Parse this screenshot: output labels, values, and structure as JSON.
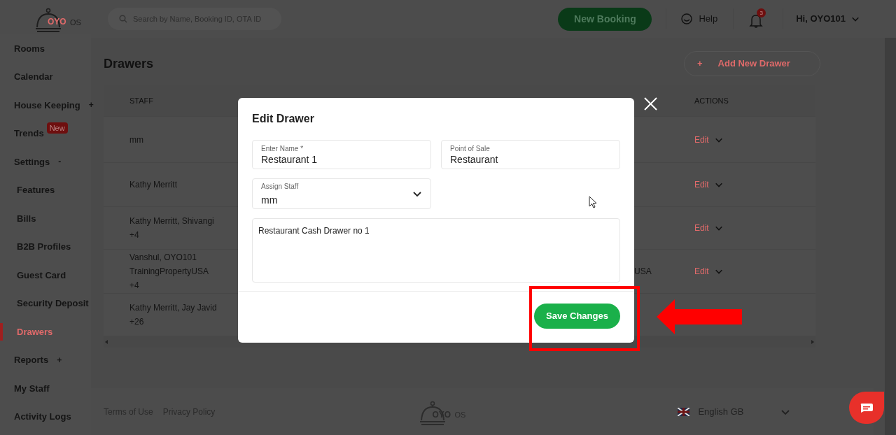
{
  "header": {
    "logo": "OYO",
    "logo_suffix": "OS",
    "search": {
      "placeholder": "Search by Name, Booking ID, OTA ID"
    },
    "new_booking": "New Booking",
    "help": "Help",
    "notifications": "3",
    "user": "Hi, OYO101"
  },
  "sidebar": {
    "items": [
      {
        "label": "Rooms",
        "selected": false
      },
      {
        "label": "Calendar",
        "selected": false
      },
      {
        "label": "House Keeping",
        "toggle": "+",
        "selected": false
      },
      {
        "label": "Trends",
        "badge": "New",
        "selected": false
      },
      {
        "label": "Settings",
        "toggle": "-",
        "selected": false,
        "children": [
          {
            "label": "Features",
            "selected": false
          },
          {
            "label": "Bills",
            "selected": false
          },
          {
            "label": "B2B Profiles",
            "selected": false
          },
          {
            "label": "Guest Card",
            "selected": false
          },
          {
            "label": "Security Deposit",
            "selected": false
          },
          {
            "label": "Drawers",
            "selected": true
          }
        ]
      },
      {
        "label": "Reports",
        "toggle": "+",
        "selected": false
      },
      {
        "label": "My Staff",
        "selected": false
      },
      {
        "label": "Activity Logs",
        "selected": false
      }
    ]
  },
  "page": {
    "title": "Drawers",
    "add_icon": "+",
    "add_button": "Add New Drawer"
  },
  "table": {
    "columns": [
      "STAFF",
      "ACTIONS"
    ],
    "rows": [
      {
        "staff": [
          "mm"
        ],
        "action": "Edit"
      },
      {
        "staff": [
          "Kathy Merritt"
        ],
        "action": "Edit"
      },
      {
        "staff": [
          "Kathy Merritt, Shivangi",
          "+4"
        ],
        "action": "Edit"
      },
      {
        "staff": [
          "Vanshul, OYO101",
          "TrainingPropertyUSA",
          "+4"
        ],
        "column_2": "USA",
        "action": "Edit"
      },
      {
        "staff": [
          "Kathy Merritt, Jay Javid",
          "+26"
        ]
      }
    ]
  },
  "modal": {
    "title": "Edit Drawer",
    "fields": [
      {
        "kind": "text",
        "label": "Enter Name *",
        "value": "Restaurant 1"
      },
      {
        "kind": "text",
        "label": "Point of Sale",
        "value": "Restaurant"
      },
      {
        "kind": "select",
        "label": "Assign Staff",
        "value": "mm"
      },
      {
        "kind": "textarea",
        "value": "Restaurant Cash Drawer no 1"
      }
    ],
    "save_button": "Save Changes"
  },
  "footer": {
    "links": [
      "Terms of Use",
      "Privacy Policy"
    ],
    "logo": "OYO",
    "logo_suffix": "OS",
    "language": "English GB"
  }
}
